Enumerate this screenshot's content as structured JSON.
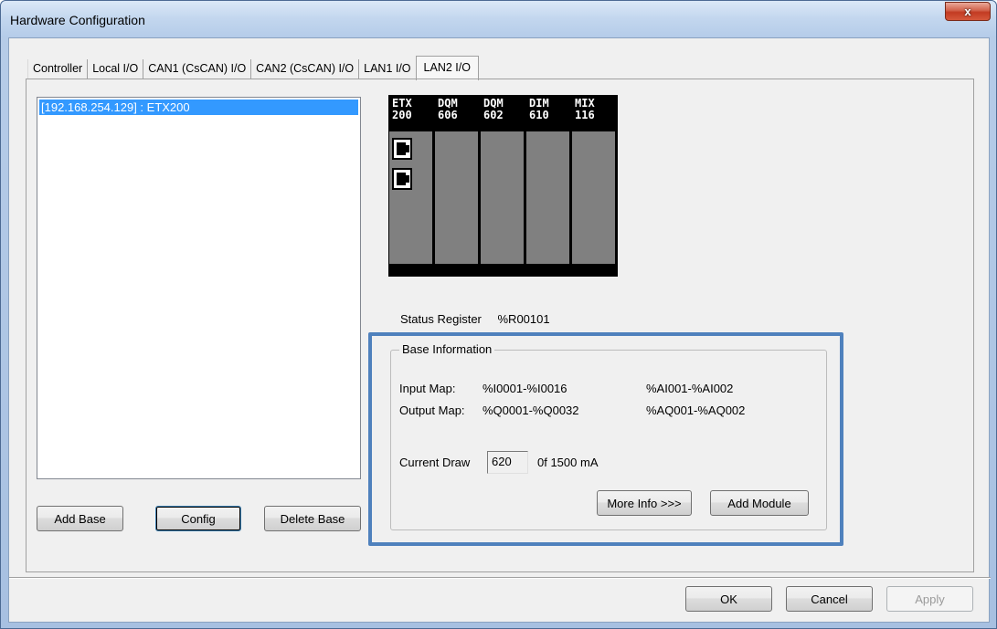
{
  "window": {
    "title": "Hardware Configuration",
    "close_glyph": "x"
  },
  "tabs": [
    {
      "label": "Controller",
      "active": false
    },
    {
      "label": "Local I/O",
      "active": false
    },
    {
      "label": "CAN1 (CsCAN) I/O",
      "active": false
    },
    {
      "label": "CAN2 (CsCAN) I/O",
      "active": false
    },
    {
      "label": "LAN1 I/O",
      "active": false
    },
    {
      "label": "LAN2 I/O",
      "active": true
    }
  ],
  "base_list": {
    "items": [
      {
        "label": "[192.168.254.129] : ETX200",
        "selected": true
      }
    ]
  },
  "base_buttons": {
    "add_base": "Add Base",
    "config": "Config",
    "delete_base": "Delete Base"
  },
  "rack": {
    "modules": [
      {
        "line1": "ETX",
        "line2": "200",
        "ports": 2
      },
      {
        "line1": "DQM",
        "line2": "606",
        "ports": 0
      },
      {
        "line1": "DQM",
        "line2": "602",
        "ports": 0
      },
      {
        "line1": "DIM",
        "line2": "610",
        "ports": 0
      },
      {
        "line1": "MIX",
        "line2": "116",
        "ports": 0
      }
    ],
    "port_icon": "ethernet-port-icon"
  },
  "status": {
    "label": "Status Register",
    "value": "%R00101"
  },
  "base_info": {
    "group_title": "Base Information",
    "input_map_label": "Input Map:",
    "input_map_digital": "%I0001-%I0016",
    "input_map_analog": "%AI001-%AI002",
    "output_map_label": "Output Map:",
    "output_map_digital": "%Q0001-%Q0032",
    "output_map_analog": "%AQ001-%AQ002",
    "current_draw_label": "Current Draw",
    "current_draw_value": "620",
    "current_draw_of": "0f 1500 mA",
    "more_info": "More Info >>>",
    "add_module": "Add Module"
  },
  "dialog_buttons": {
    "ok": "OK",
    "cancel": "Cancel",
    "apply": "Apply"
  },
  "colors": {
    "selection": "#3399ff",
    "highlight_border": "#4f81bd",
    "rack_body": "#808080"
  }
}
